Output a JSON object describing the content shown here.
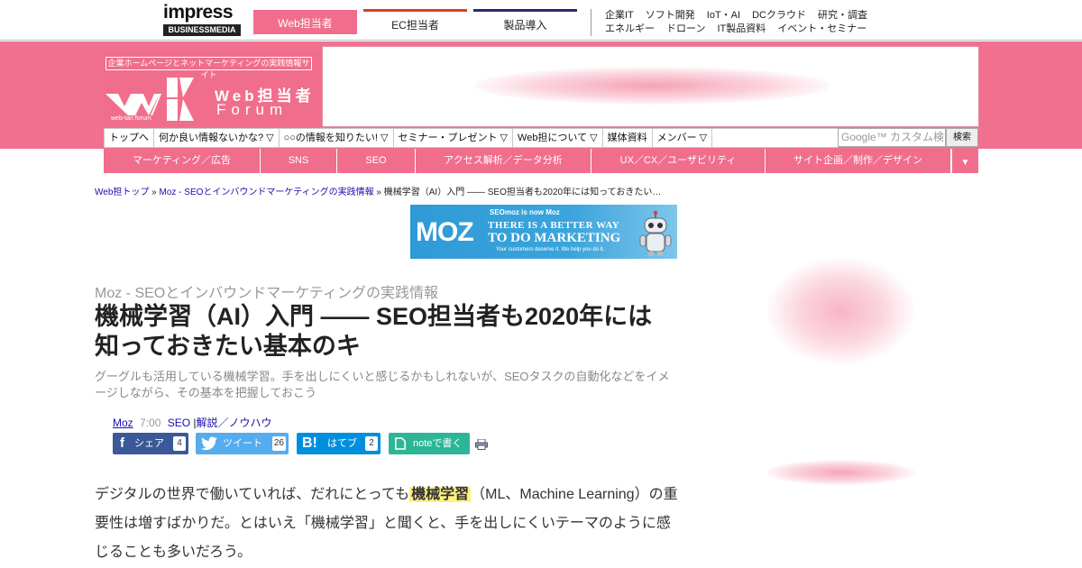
{
  "topbar": {
    "brand_word": "impress",
    "brand_sub": "BUSINESSMEDIA",
    "tabs": [
      {
        "label": "Web担当者"
      },
      {
        "label": "EC担当者"
      },
      {
        "label": "製品導入"
      }
    ],
    "links_row1": [
      "企業IT",
      "ソフト開発",
      "IoT・AI",
      "DCクラウド",
      "研究・調査"
    ],
    "links_row2": [
      "エネルギー",
      "ドローン",
      "IT製品資料",
      "イベント・セミナー"
    ]
  },
  "header": {
    "tagline": "企業ホームページとネットマーケティングの実践情報サイト",
    "logo_line1": "Web担当者",
    "logo_line2": "Forum",
    "logo_small": "web-tan forum"
  },
  "nav": {
    "items": [
      "トップへ",
      "何か良い情報ないかな? ▽",
      "○○の情報を知りたい! ▽",
      "セミナー・プレゼント ▽",
      "Web担について ▽",
      "媒体資料",
      "メンバー ▽"
    ],
    "search_placeholder": "Google™ カスタム検索",
    "search_button": "検索"
  },
  "categories": [
    "マーケティング／広告",
    "SNS",
    "SEO",
    "アクセス解析／データ分析",
    "UX／CX／ユーザビリティ",
    "サイト企画／制作／デザイン"
  ],
  "category_toggle": "▼",
  "breadcrumb": {
    "home": "Web担トップ",
    "sep": " » ",
    "section": "Moz - SEOとインバウンドマーケティングの実践情報",
    "current": "機械学習（AI）入門 —— SEO担当者も2020年には知っておきたい…"
  },
  "moz_ad": {
    "logo": "MOZ",
    "small": "SEOmoz is now Moz",
    "line1": "THERE IS A BETTER WAY",
    "line2": "TO DO MARKETING",
    "line3": "Your customers deserve it. We help you do it."
  },
  "article": {
    "series": "Moz - SEOとインバウンドマーケティングの実践情報",
    "title": "機械学習（AI）入門 —— SEO担当者も2020年には知っておきたい基本のキ",
    "lede": "グーグルも活用している機械学習。手を出しにくいと感じるかもしれないが、SEOタスクの自動化などをイメージしながら、その基本を把握しておこう",
    "author": "Moz",
    "time": "7:00",
    "category1": "SEO",
    "category_sep": "|",
    "category2": "解説／ノウハウ"
  },
  "share": {
    "facebook": {
      "icon": "f",
      "label": "シェア",
      "count": "4"
    },
    "twitter": {
      "label": "ツイート",
      "count": "26"
    },
    "hatena": {
      "icon": "B!",
      "label": "はてブ",
      "count": "2"
    },
    "note": {
      "label": "noteで書く"
    }
  },
  "body": {
    "p1_before": "デジタルの世界で働いていれば、だれにとっても",
    "p1_highlight": "機械学習",
    "p1_after": "（ML、Machine Learning）の重要性は増すばかりだ。とはいえ「機械学習」と聞くと、手を出しにくいテーマのように感じることも多いだろう。"
  },
  "colors": {
    "brand_pink": "#f06e8c",
    "header_pink": "#f2708f",
    "ec_orange": "#d9401e",
    "prod_navy": "#2a2a70",
    "facebook": "#3b5998",
    "twitter": "#55acee",
    "hatena": "#008fde",
    "note": "#2cb696",
    "highlight": "#fff27d"
  }
}
